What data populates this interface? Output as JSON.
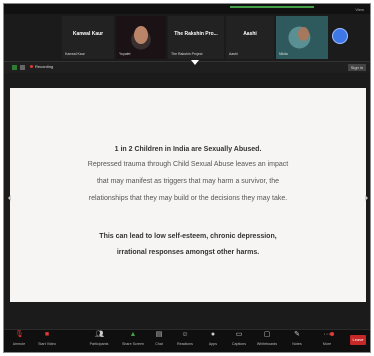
{
  "top": {
    "view_label": "View"
  },
  "participants": [
    {
      "name": "Kanwal Kaur",
      "sub": "Kanwal Kaur"
    },
    {
      "name": "",
      "sub": "Yuyalet"
    },
    {
      "name": "The Rakshin Pro...",
      "sub": "The Rakshin Project"
    },
    {
      "name": "Aashi",
      "sub": "Aashi"
    },
    {
      "name": "",
      "sub": "Nikita"
    }
  ],
  "sharebar": {
    "recording": "Recording",
    "signin": "Sign in"
  },
  "slide": {
    "line1": "1 in 2 Children in India are Sexually Abused.",
    "line2": "Repressed trauma through Child Sexual Abuse leaves an impact",
    "line3": "that may manifest as triggers that may harm a survivor, the",
    "line4": "relationships that they may build or the decisions they may take.",
    "line5": "This can lead to low self-esteem, chronic depression,",
    "line6": "irrational responses amongst other harms."
  },
  "toolbar": {
    "items": [
      {
        "label": "Unmute",
        "icon": "microphone-icon"
      },
      {
        "label": "Start Video",
        "icon": "video-camera-icon"
      },
      {
        "label": "Participants",
        "icon": "participants-icon"
      },
      {
        "label": "Share Screen",
        "icon": "share-screen-icon"
      },
      {
        "label": "Chat",
        "icon": "chat-icon"
      },
      {
        "label": "Reactions",
        "icon": "reactions-icon"
      },
      {
        "label": "Apps",
        "icon": "apps-icon"
      },
      {
        "label": "Captions",
        "icon": "captions-icon"
      },
      {
        "label": "Whiteboards",
        "icon": "whiteboard-icon"
      },
      {
        "label": "Notes",
        "icon": "notes-icon"
      },
      {
        "label": "More",
        "icon": "more-icon"
      }
    ],
    "end_label": "Leave",
    "colors": {
      "share": "#2e7d32",
      "end": "#c62828"
    }
  }
}
